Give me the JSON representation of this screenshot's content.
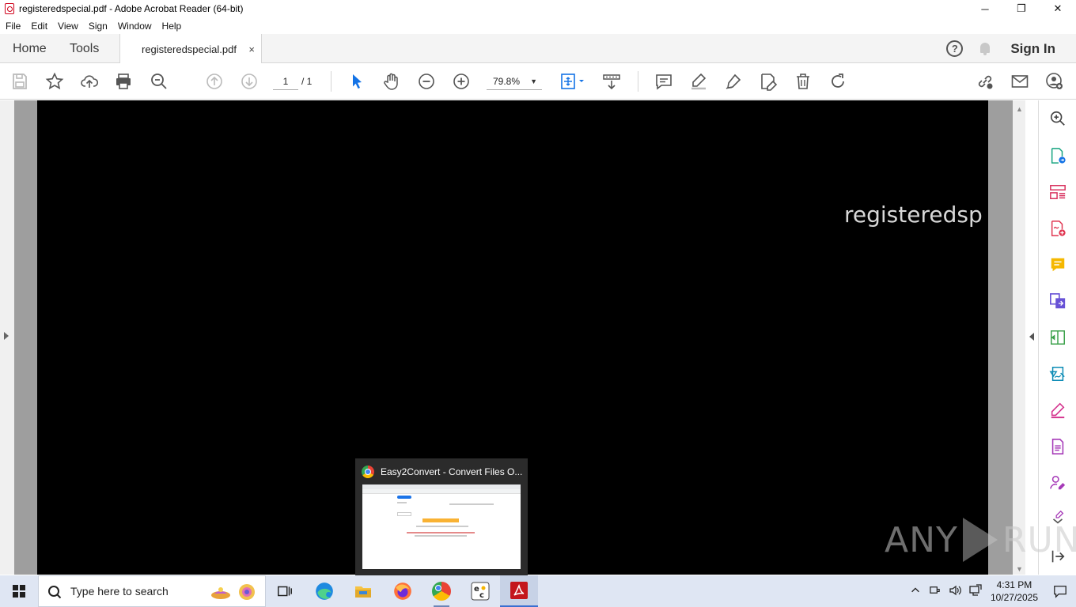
{
  "window": {
    "title": "registeredspecial.pdf - Adobe Acrobat Reader (64-bit)",
    "minimize": "─",
    "maximize": "❐",
    "close": "✕"
  },
  "menu": [
    "File",
    "Edit",
    "View",
    "Sign",
    "Window",
    "Help"
  ],
  "tabs": {
    "home": "Home",
    "tools": "Tools",
    "document": "registeredspecial.pdf",
    "close_symbol": "×"
  },
  "header": {
    "help": "?",
    "sign_in": "Sign In"
  },
  "toolbar": {
    "page_current": "1",
    "page_total": "/ 1",
    "zoom": "79.8%",
    "zoom_caret": "▼"
  },
  "document": {
    "page_text": "registeredsp"
  },
  "scrollbar": {
    "up": "▲",
    "down": "▼"
  },
  "watermark": {
    "left": "ANY",
    "right": "RUN"
  },
  "thumbnail": {
    "title": "Easy2Convert - Convert Files O..."
  },
  "taskbar": {
    "search_placeholder": "Type here to search",
    "time": "4:31 PM",
    "date": "10/27/2025"
  },
  "colors": {
    "acrobat_red": "#d0021b",
    "tool_blue": "#1473e6",
    "taskbar_bg": "#dfe6f3"
  }
}
